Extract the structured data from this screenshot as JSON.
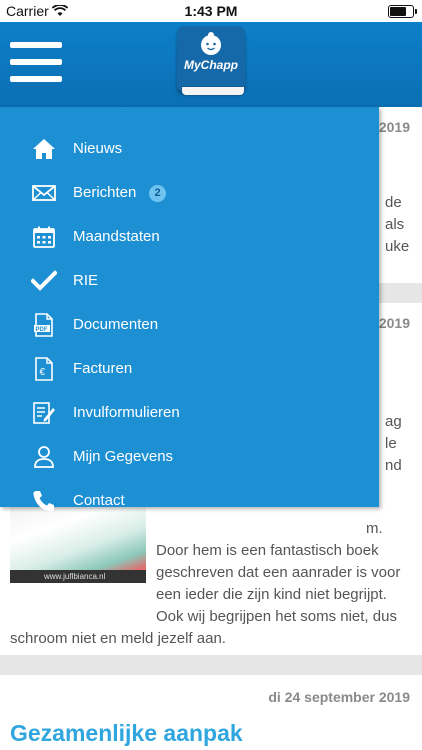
{
  "status_bar": {
    "carrier": "Carrier",
    "time": "1:43 PM",
    "battery_level": 0.8
  },
  "header": {
    "logo_text": "MyChapp"
  },
  "menu": {
    "items": [
      {
        "label": "Nieuws",
        "icon": "home-icon"
      },
      {
        "label": "Berichten",
        "icon": "envelope-icon",
        "badge": "2"
      },
      {
        "label": "Maandstaten",
        "icon": "calendar-icon"
      },
      {
        "label": "RIE",
        "icon": "checkmark-icon"
      },
      {
        "label": "Documenten",
        "icon": "pdf-document-icon"
      },
      {
        "label": "Facturen",
        "icon": "euro-invoice-icon"
      },
      {
        "label": "Invulformulieren",
        "icon": "form-pencil-icon"
      },
      {
        "label": "Mijn Gegevens",
        "icon": "user-icon"
      },
      {
        "label": "Contact",
        "icon": "phone-icon"
      }
    ]
  },
  "feed": {
    "card1": {
      "date_fragment": "2019",
      "line1": "de",
      "line2": "als",
      "line3": "uke"
    },
    "card2": {
      "date_fragment": "2019",
      "line1": "ag",
      "line2": "le",
      "line3": "nd",
      "line4": "m.",
      "line5": "Door hem is een fantastisch boek",
      "line6": "geschreven dat een aanrader is voor",
      "line7": "een ieder die zijn kind niet begrijpt.",
      "line8": "Ook wij begrijpen het soms niet, dus",
      "line9": "schroom niet en meld jezelf aan.",
      "image_caption": "www.juflbianca.nl"
    },
    "card3": {
      "date": "di 24 september 2019",
      "headline": "Gezamenlijke aanpak"
    }
  },
  "colors": {
    "header": "#0d7fc8",
    "drawer": "#1d8fd3",
    "badge": "#6fc3ef",
    "headline": "#2fa6de"
  }
}
